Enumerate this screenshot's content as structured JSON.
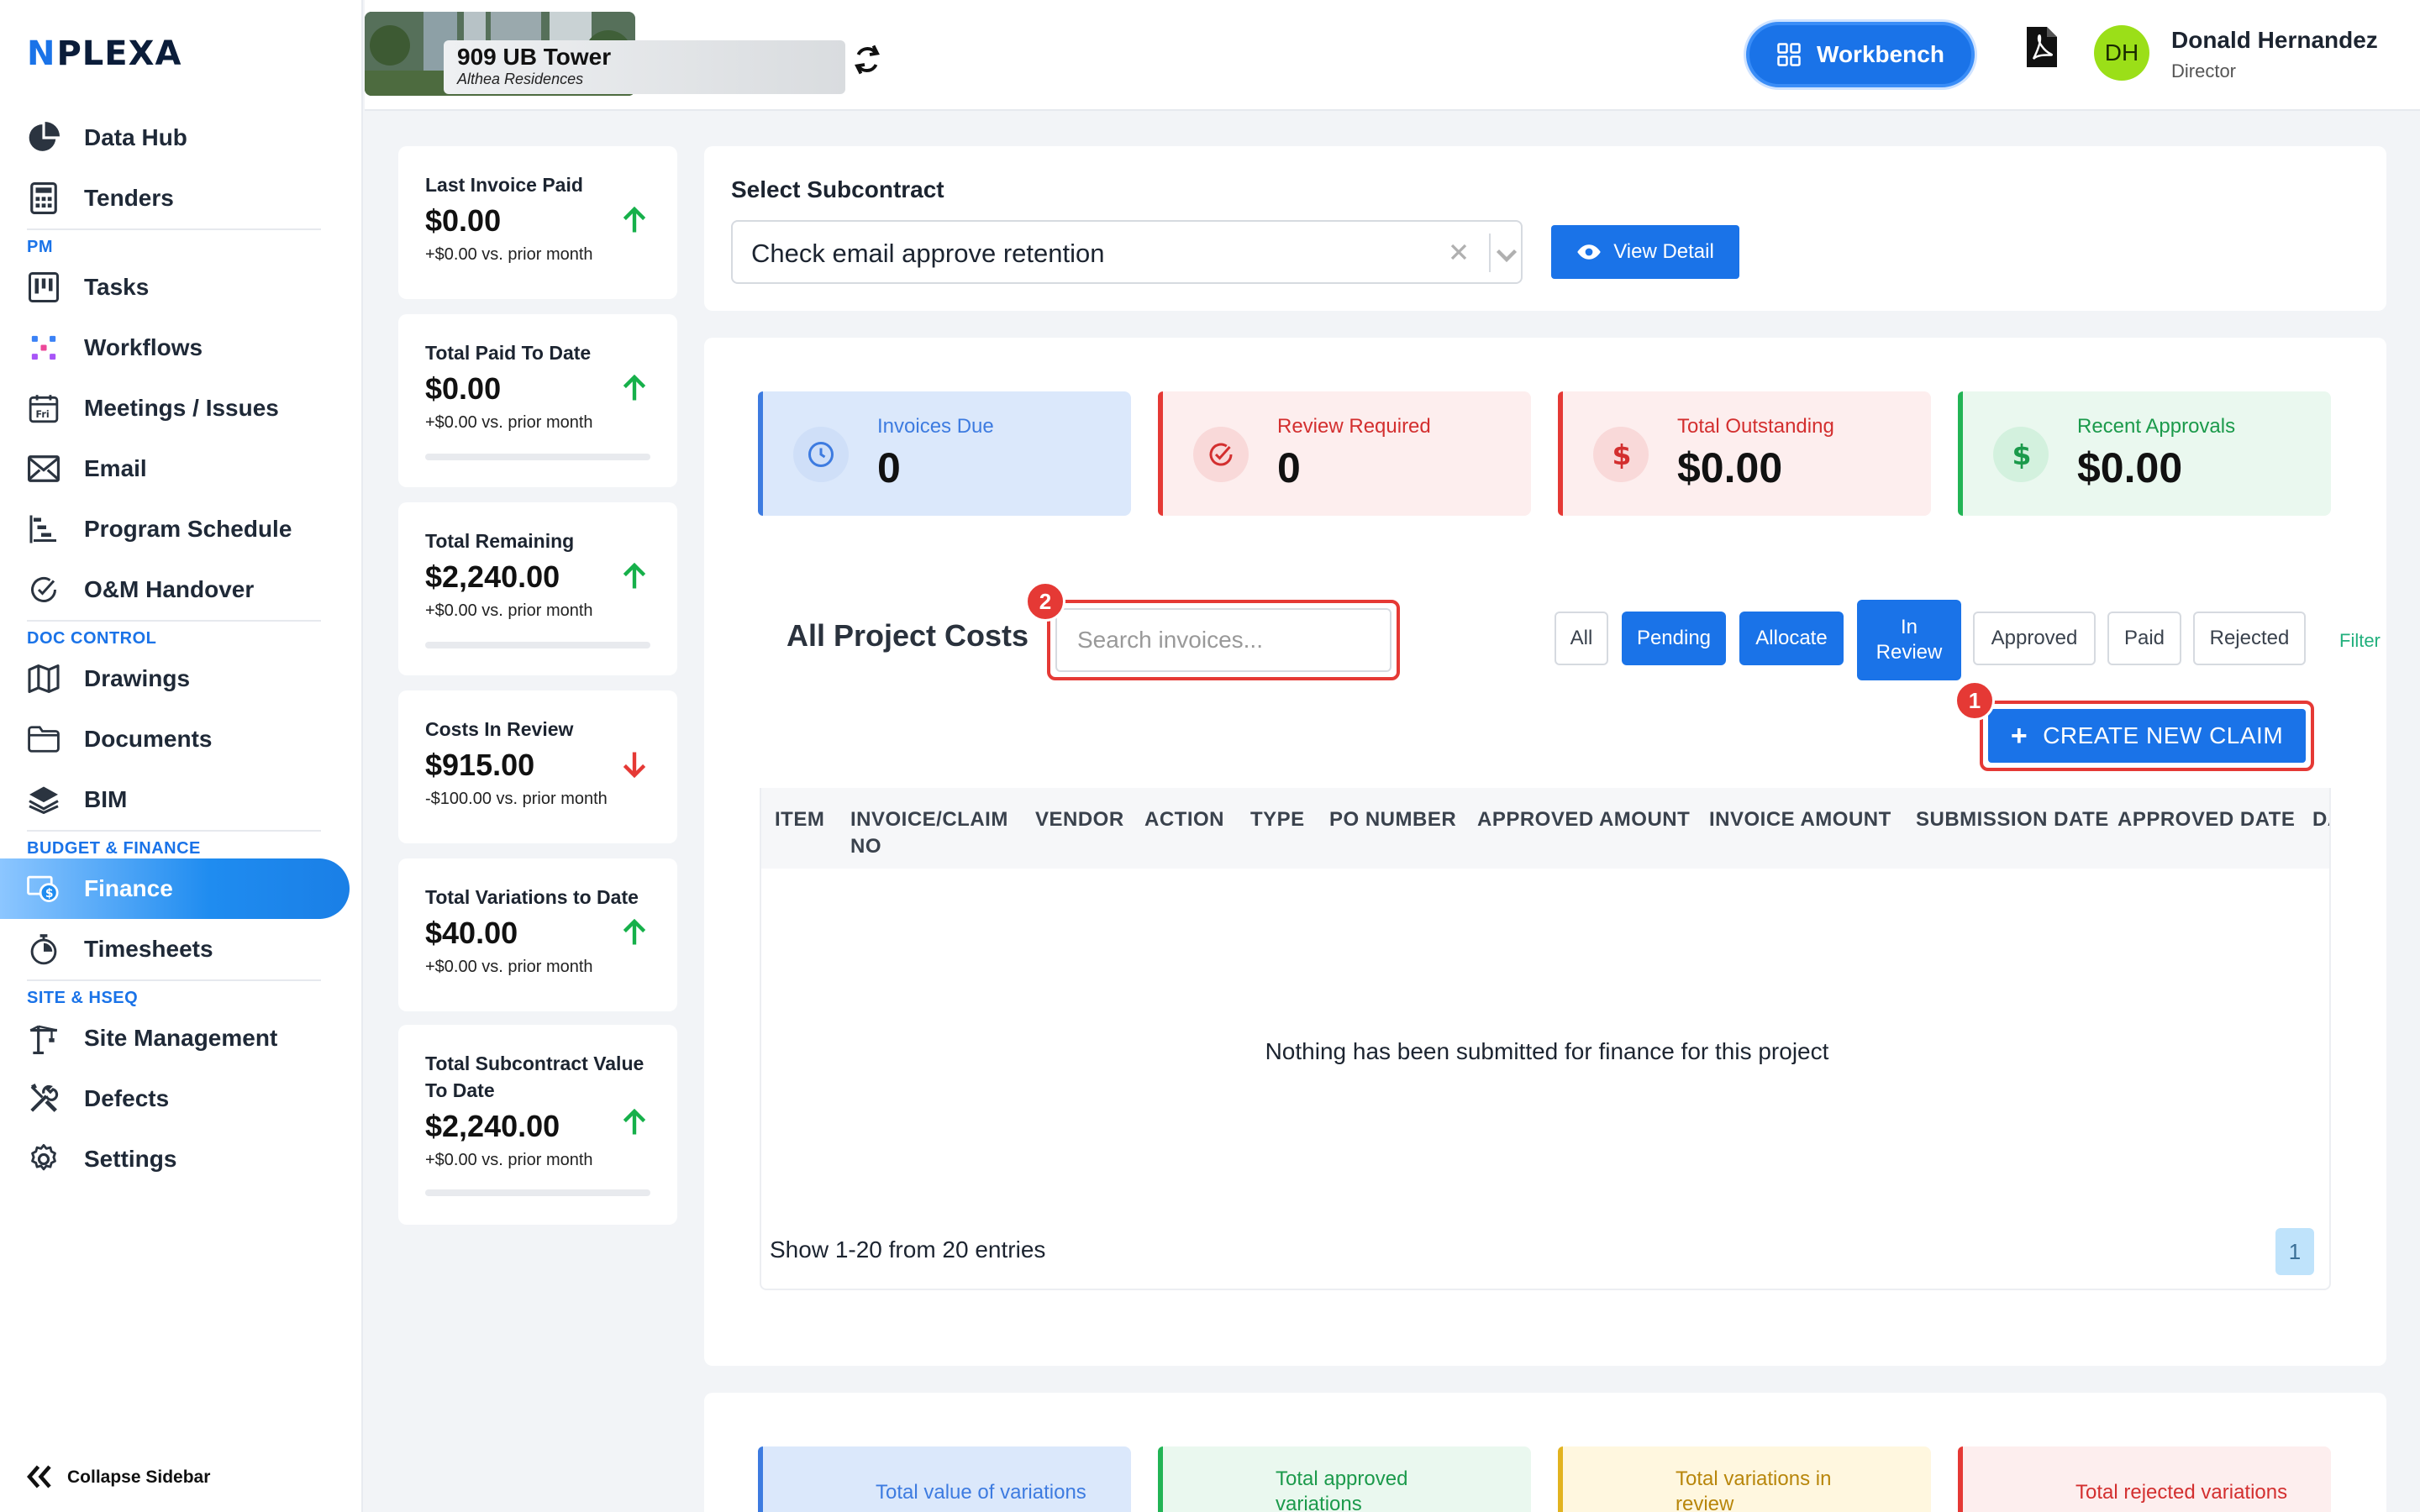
{
  "brand": {
    "logo_mark": "N",
    "logo_text": "PLEXA"
  },
  "sidebar": {
    "items_top": [
      {
        "label": "Data Hub",
        "icon": "pie-chart-icon"
      },
      {
        "label": "Tenders",
        "icon": "calculator-icon"
      }
    ],
    "sections": [
      {
        "title": "PM",
        "items": [
          {
            "label": "Tasks",
            "icon": "kanban-icon"
          },
          {
            "label": "Workflows",
            "icon": "workflow-icon"
          },
          {
            "label": "Meetings / Issues",
            "icon": "calendar-icon"
          },
          {
            "label": "Email",
            "icon": "envelope-icon"
          },
          {
            "label": "Program Schedule",
            "icon": "gantt-icon"
          },
          {
            "label": "O&M Handover",
            "icon": "check-circle-icon"
          }
        ]
      },
      {
        "title": "DOC CONTROL",
        "items": [
          {
            "label": "Drawings",
            "icon": "map-icon"
          },
          {
            "label": "Documents",
            "icon": "folder-icon"
          },
          {
            "label": "BIM",
            "icon": "layers-icon"
          }
        ]
      },
      {
        "title": "BUDGET & FINANCE",
        "items": [
          {
            "label": "Finance",
            "icon": "finance-icon",
            "active": true
          },
          {
            "label": "Timesheets",
            "icon": "stopwatch-icon"
          }
        ]
      },
      {
        "title": "SITE & HSEQ",
        "items": [
          {
            "label": "Site Management",
            "icon": "crane-icon"
          },
          {
            "label": "Defects",
            "icon": "tools-icon"
          },
          {
            "label": "Settings",
            "icon": "gear-icon"
          }
        ]
      }
    ],
    "collapse_label": "Collapse Sidebar"
  },
  "topbar": {
    "project_name": "909 UB Tower",
    "project_sub": "Althea Residences",
    "workbench_label": "Workbench",
    "user_initials": "DH",
    "user_name": "Donald Hernandez",
    "user_role": "Director"
  },
  "stats": [
    {
      "label": "Last Invoice Paid",
      "value": "$0.00",
      "compare": "+$0.00 vs. prior month",
      "trend": "up"
    },
    {
      "label": "Total Paid To Date",
      "value": "$0.00",
      "compare": "+$0.00 vs. prior month",
      "trend": "up"
    },
    {
      "label": "Total Remaining",
      "value": "$2,240.00",
      "compare": "+$0.00 vs. prior month",
      "trend": "up"
    },
    {
      "label": "Costs In Review",
      "value": "$915.00",
      "compare": "-$100.00 vs. prior month",
      "trend": "down"
    },
    {
      "label": "Total Variations to Date",
      "value": "$40.00",
      "compare": "+$0.00 vs. prior month",
      "trend": "up"
    },
    {
      "label": "Total Subcontract Value To Date",
      "value": "$2,240.00",
      "compare": "+$0.00 vs. prior month",
      "trend": "up"
    }
  ],
  "subcontract": {
    "title": "Select Subcontract",
    "selected": "Check email approve retention",
    "view_detail_label": "View Detail"
  },
  "kpis": [
    {
      "label": "Invoices Due",
      "value": "0",
      "icon": "clock-icon",
      "color": "#3d7be0",
      "bg": "#dbe8fb",
      "bar": "#3d7be0"
    },
    {
      "label": "Review Required",
      "value": "0",
      "icon": "check-badge-icon",
      "color": "#d32f2f",
      "bg": "#fdeeee",
      "bar": "#e53935"
    },
    {
      "label": "Total Outstanding",
      "value": "$0.00",
      "icon": "dollar-icon",
      "color": "#d32f2f",
      "bg": "#fdeeee",
      "bar": "#e53935"
    },
    {
      "label": "Recent Approvals",
      "value": "$0.00",
      "icon": "dollar-icon",
      "color": "#1b9a4b",
      "bg": "#eaf8ef",
      "bar": "#22b455"
    }
  ],
  "costs": {
    "title": "All Project Costs",
    "search_placeholder": "Search invoices...",
    "filters": [
      {
        "label": "All",
        "style": "outline"
      },
      {
        "label": "Pending",
        "style": "solid"
      },
      {
        "label": "Allocate",
        "style": "solid"
      },
      {
        "label": "In Review",
        "style": "solid"
      },
      {
        "label": "Approved",
        "style": "outline"
      },
      {
        "label": "Paid",
        "style": "outline"
      },
      {
        "label": "Rejected",
        "style": "outline"
      }
    ],
    "filter_link": "Filter",
    "create_label": "CREATE NEW CLAIM",
    "annotation_1": "1",
    "annotation_2": "2",
    "columns": [
      "ITEM",
      "INVOICE/CLAIM NO",
      "VENDOR",
      "ACTION",
      "TYPE",
      "PO NUMBER",
      "APPROVED AMOUNT",
      "INVOICE AMOUNT",
      "SUBMISSION DATE",
      "APPROVED DATE",
      "DA"
    ],
    "empty_message": "Nothing has been submitted for finance for this project",
    "entries_text": "Show 1-20 from 20 entries",
    "page": "1"
  },
  "variations": [
    {
      "label": "Total value of variations",
      "color": "#3d7be0",
      "bg": "#dbe8fb"
    },
    {
      "label": "Total approved variations",
      "color": "#1b9a4b",
      "bg": "#eaf8ef"
    },
    {
      "label": "Total variations in review",
      "color": "#b8860b",
      "bg": "#fff7df"
    },
    {
      "label": "Total rejected variations",
      "color": "#d32f2f",
      "bg": "#fdeeee"
    }
  ]
}
